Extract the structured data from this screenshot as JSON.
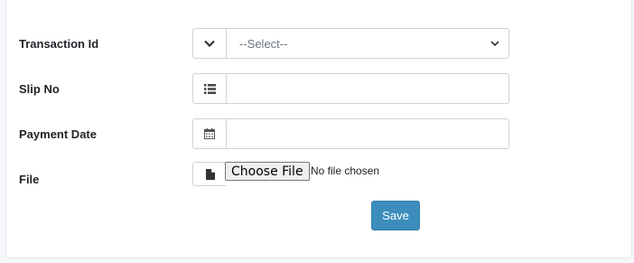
{
  "form": {
    "transaction_id": {
      "label": "Transaction Id",
      "icon": "chevron-down-icon",
      "selected": "--Select--"
    },
    "slip_no": {
      "label": "Slip No",
      "icon": "list-icon",
      "value": ""
    },
    "payment_date": {
      "label": "Payment Date",
      "icon": "calendar-icon",
      "value": ""
    },
    "file": {
      "label": "File",
      "icon": "file-icon",
      "button_label": "Choose File",
      "status": "No file chosen"
    },
    "save_label": "Save"
  },
  "colors": {
    "primary": "#3c8dbc",
    "border": "#ced4da",
    "background": "#f4f6f9"
  }
}
